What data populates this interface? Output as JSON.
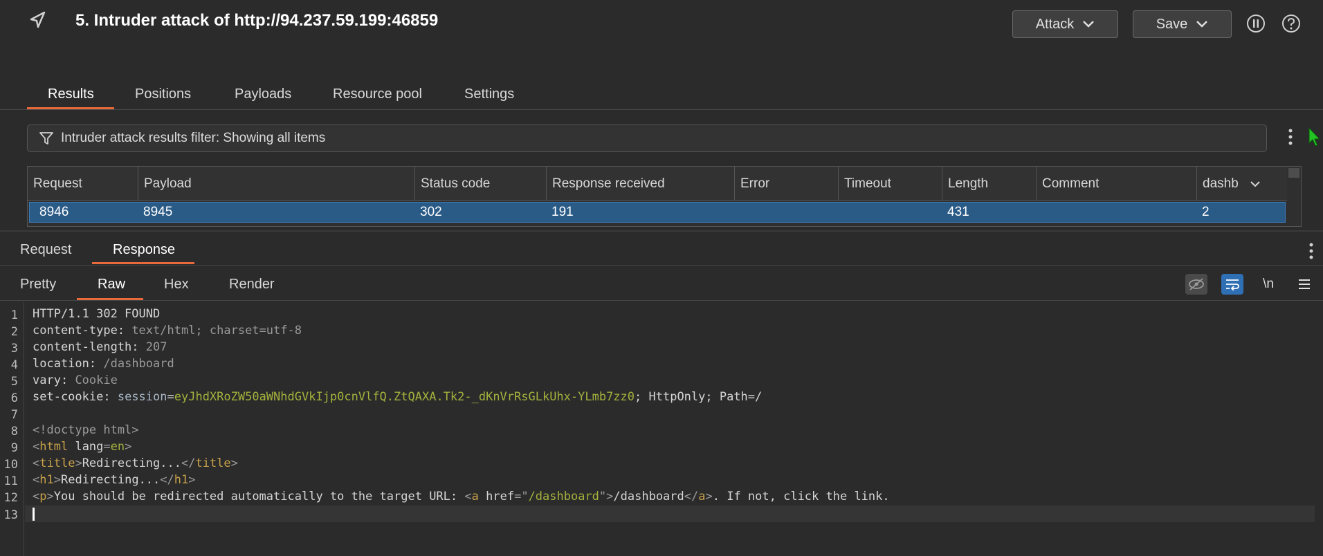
{
  "header": {
    "title": "5. Intruder attack of http://94.237.59.199:46859",
    "attack_label": "Attack",
    "save_label": "Save"
  },
  "top_tabs": [
    "Results",
    "Positions",
    "Payloads",
    "Resource pool",
    "Settings"
  ],
  "filter": {
    "text": "Intruder attack results filter: Showing all items"
  },
  "table": {
    "columns": [
      "Request",
      "Payload",
      "Status code",
      "Response received",
      "Error",
      "Timeout",
      "Length",
      "Comment",
      "dashb"
    ],
    "rows": [
      {
        "request": "8946",
        "payload": "8945",
        "status": "302",
        "received": "191",
        "error": "",
        "timeout": "",
        "length": "431",
        "comment": "",
        "dashb": "2"
      }
    ]
  },
  "rr_tabs": [
    "Request",
    "Response"
  ],
  "view_tabs": [
    "Pretty",
    "Raw",
    "Hex",
    "Render"
  ],
  "toolbar": {
    "newline_label": "\\n"
  },
  "response": {
    "status_line": "HTTP/1.1 302 FOUND",
    "headers": [
      {
        "name": "content-type",
        "value": "text/html; charset=utf-8"
      },
      {
        "name": "content-length",
        "value": "207"
      },
      {
        "name": "location",
        "value": "/dashboard"
      },
      {
        "name": "vary",
        "value": "Cookie"
      }
    ],
    "set_cookie": {
      "name": "set-cookie",
      "cookie_name": "session",
      "cookie_value": "eyJhdXRoZW50aWNhdGVkIjp0cnVlfQ.ZtQAXA.Tk2-_dKnVrRsGLkUhx-YLmb7zz0",
      "flags": "; HttpOnly; Path=/"
    },
    "body": {
      "doctype": "<!doctype html>",
      "html_tag": "html",
      "lang_attr": "lang",
      "lang_value": "en",
      "title_text": "Redirecting...",
      "h1_text": "Redirecting...",
      "p_text": "You should be redirected automatically to the target URL: ",
      "href_value": "/dashboard",
      "link_text": "/dashboard",
      "p_tail": ". If not, click the link."
    },
    "line_numbers": [
      "1",
      "2",
      "3",
      "4",
      "5",
      "6",
      "7",
      "8",
      "9",
      "10",
      "11",
      "12",
      "13"
    ]
  }
}
